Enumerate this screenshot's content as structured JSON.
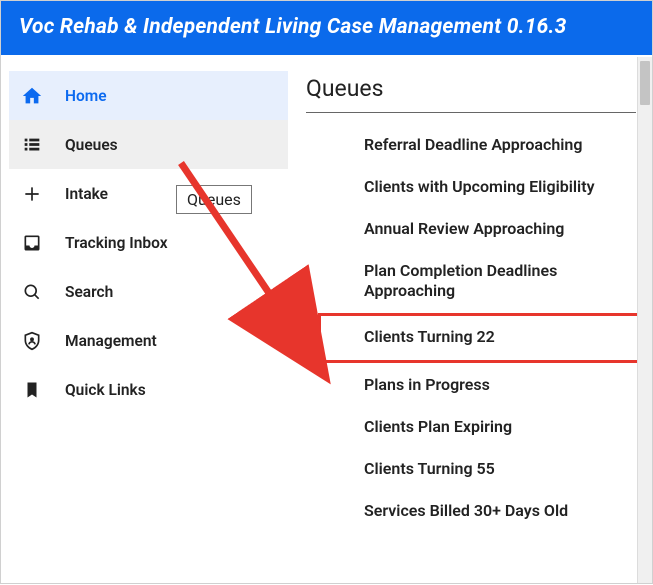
{
  "app": {
    "title": "Voc Rehab & Independent Living Case Management 0.16.3"
  },
  "sidebar": {
    "items": [
      {
        "label": "Home"
      },
      {
        "label": "Queues"
      },
      {
        "label": "Intake"
      },
      {
        "label": "Tracking Inbox"
      },
      {
        "label": "Search"
      },
      {
        "label": "Management"
      },
      {
        "label": "Quick Links"
      }
    ],
    "tooltip": "Queues"
  },
  "queues": {
    "heading": "Queues",
    "items": [
      "Referral Deadline Approaching",
      "Clients with Upcoming Eligibility",
      "Annual Review Approaching",
      "Plan Completion Deadlines Approaching",
      "Clients Turning 22",
      "Plans in Progress",
      "Clients Plan Expiring",
      "Clients Turning 55",
      "Services Billed 30+ Days Old"
    ],
    "highlight_index": 4
  },
  "colors": {
    "topbar": "#0b6aeb",
    "accent": "#0c6af0",
    "annotation": "#e7352c"
  }
}
